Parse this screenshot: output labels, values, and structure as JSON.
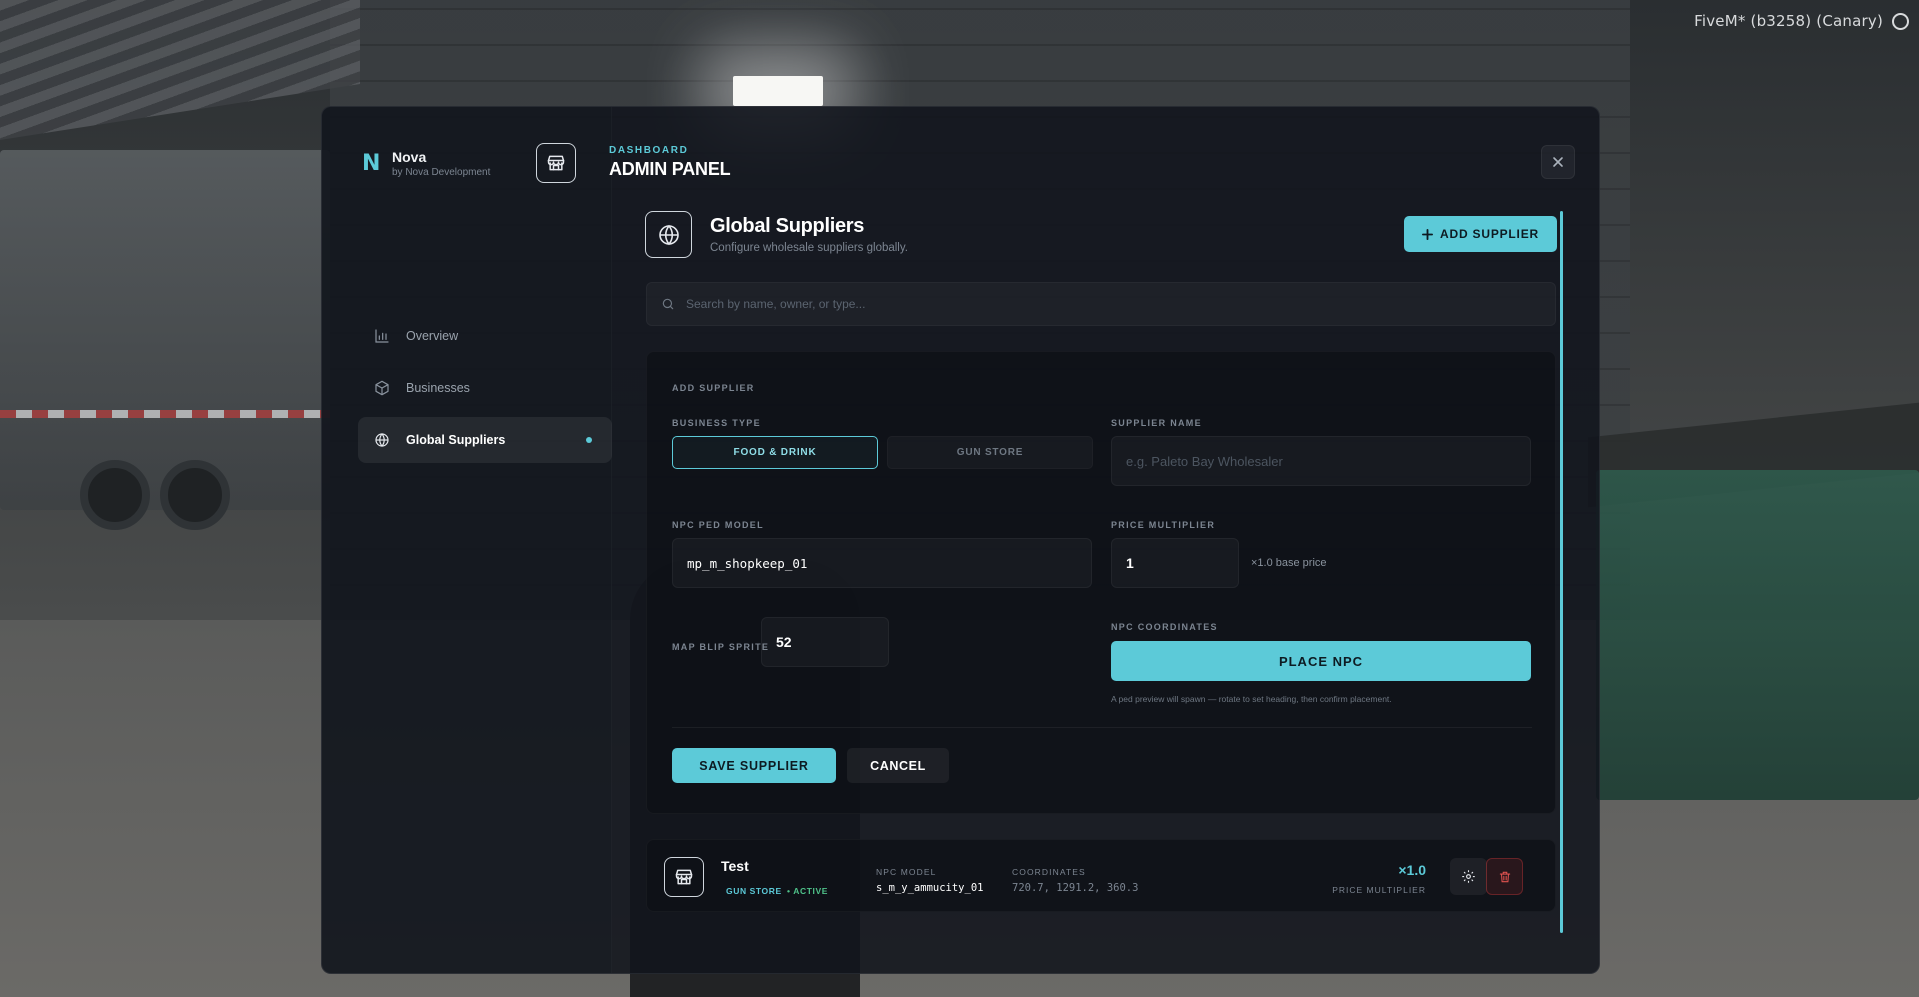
{
  "window": {
    "title": "FiveM* (b3258) (Canary)"
  },
  "brand": {
    "logo": "N",
    "name": "Nova",
    "subtitle": "by Nova Development"
  },
  "header": {
    "eyebrow": "DASHBOARD",
    "title": "ADMIN PANEL",
    "icon": "store-icon"
  },
  "close": {
    "glyph": "×"
  },
  "nav": {
    "items": [
      {
        "label": "Overview",
        "icon": "bar-chart-icon",
        "active": false
      },
      {
        "label": "Businesses",
        "icon": "box-icon",
        "active": false
      },
      {
        "label": "Global Suppliers",
        "icon": "globe-icon",
        "active": true
      }
    ]
  },
  "content": {
    "title": "Global Suppliers",
    "subtitle": "Configure wholesale suppliers globally.",
    "add_button": "ADD SUPPLIER",
    "search_placeholder": "Search by name, owner, or type..."
  },
  "form": {
    "title": "ADD SUPPLIER",
    "business_type_label": "BUSINESS TYPE",
    "business_types": [
      "FOOD & DRINK",
      "GUN STORE"
    ],
    "business_type_selected": "FOOD & DRINK",
    "supplier_name_label": "SUPPLIER NAME",
    "supplier_name_placeholder": "e.g. Paleto Bay Wholesaler",
    "npc_ped_model_label": "NPC PED MODEL",
    "npc_ped_model_value": "mp_m_shopkeep_01",
    "price_multiplier_label": "PRICE MULTIPLIER",
    "price_multiplier_value": "1",
    "price_multiplier_hint": "×1.0 base price",
    "map_blip_sprite_label": "MAP BLIP SPRITE",
    "map_blip_sprite_value": "52",
    "npc_coordinates_label": "NPC COORDINATES",
    "place_npc_button": "PLACE NPC",
    "place_npc_note": "A ped preview will spawn — rotate to set heading, then confirm placement.",
    "save_button": "SAVE SUPPLIER",
    "cancel_button": "CANCEL"
  },
  "suppliers": [
    {
      "name": "Test",
      "type_tag": "GUN STORE",
      "status_tag": "• ACTIVE",
      "npc_model_label": "NPC MODEL",
      "npc_model": "s_m_y_ammucity_01",
      "coordinates_label": "COORDINATES",
      "coordinates": "720.7, 1291.2, 360.3",
      "multiplier": "×1.0",
      "multiplier_label": "PRICE MULTIPLIER"
    }
  ],
  "colors": {
    "accent": "#5ccad8",
    "active_status": "#4fc38a",
    "danger": "#dc3c3c",
    "panel_bg": "#11151c"
  }
}
